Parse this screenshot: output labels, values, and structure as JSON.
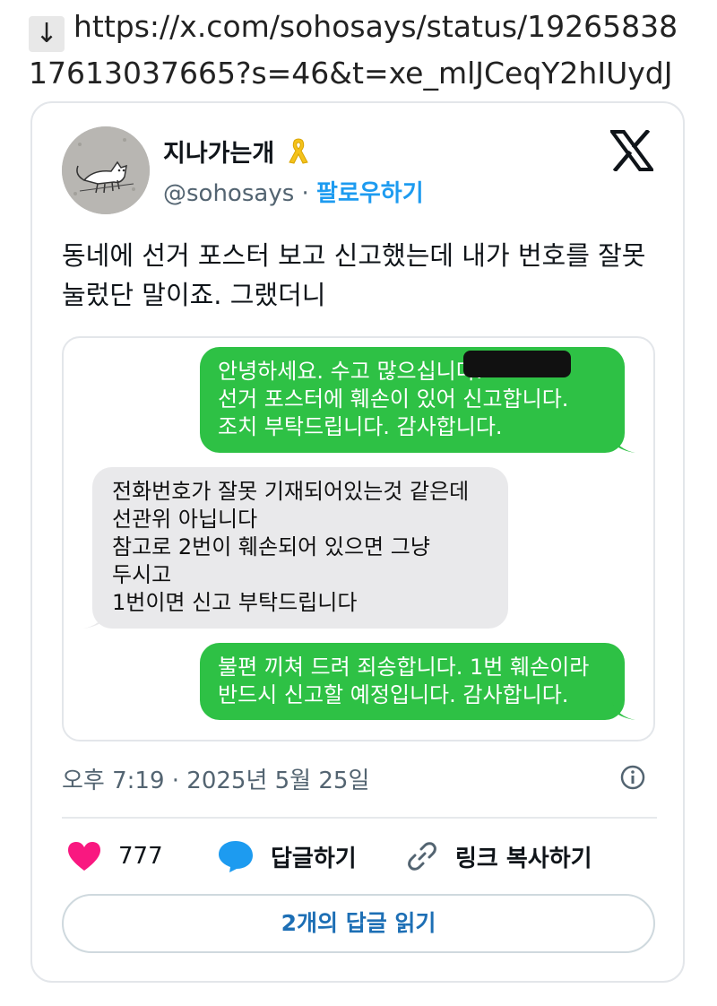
{
  "address_bar": {
    "arrow": "↓",
    "url": "https://x.com/sohosays/status/1926583817613037665?s=46&t=xe_mlJCeqY2hIUydJ"
  },
  "tweet": {
    "display_name": "지나가는개",
    "badge_icon": "yellow-ribbon-icon",
    "handle": "@sohosays",
    "separator": "·",
    "follow_label": "팔로우하기",
    "brand_icon": "x-logo-icon",
    "text": "동네에 선거 포스터 보고 신고했는데 내가 번호를 잘못 눌렀단 말이죠. 그랬더니",
    "timestamp": "오후 7:19 · 2025년 5월 25일",
    "like_count": "777",
    "reply_label": "답글하기",
    "copy_link_label": "링크 복사하기",
    "read_replies_label": "2개의 답글 읽기"
  },
  "messages": [
    {
      "direction": "outgoing",
      "text": "안녕하세요. 수고 많으십니다.\n선거 포스터에 훼손이 있어 신고합니다.\n조치 부탁드립니다. 감사합니다."
    },
    {
      "direction": "incoming",
      "text": "전화번호가 잘못 기재되어있는것 같은데\n선관위 아닙니다\n참고로 2번이 훼손되어 있으면 그냥\n두시고\n1번이면 신고 부탁드립니다"
    },
    {
      "direction": "outgoing",
      "text": "불편 끼쳐 드려 죄송합니다. 1번 훼손이라\n반드시 신고할 예정입니다. 감사합니다."
    }
  ],
  "colors": {
    "outgoing_bubble": "#2ec145",
    "incoming_bubble": "#e9e9eb",
    "follow_link": "#1d9bf0",
    "like_heart": "#f91880",
    "reply_bubble_icon": "#1d9bf0"
  }
}
